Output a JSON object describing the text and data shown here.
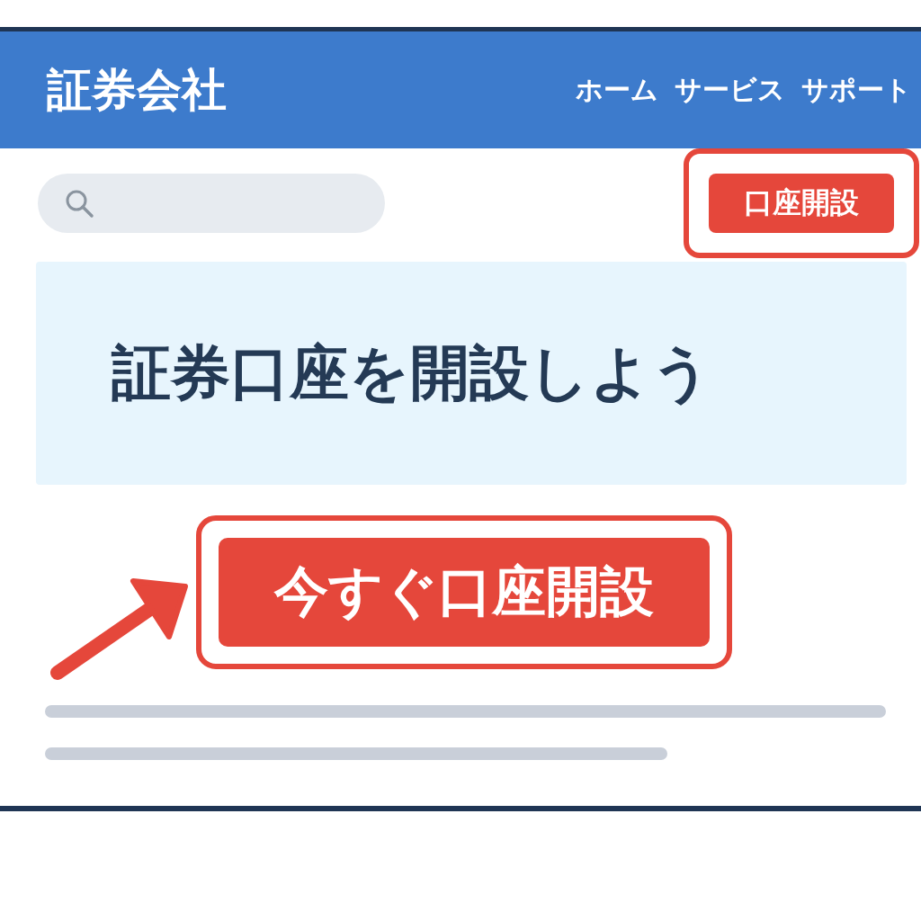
{
  "header": {
    "title": "証券会社",
    "nav": [
      {
        "label": "ホーム"
      },
      {
        "label": "サービス"
      },
      {
        "label": "サポート"
      }
    ]
  },
  "open_account_button": {
    "label": "口座開設",
    "highlighted": true
  },
  "hero": {
    "heading": "証券口座を開設しよう"
  },
  "cta_button": {
    "label": "今すぐ口座開設",
    "highlighted": true
  }
}
